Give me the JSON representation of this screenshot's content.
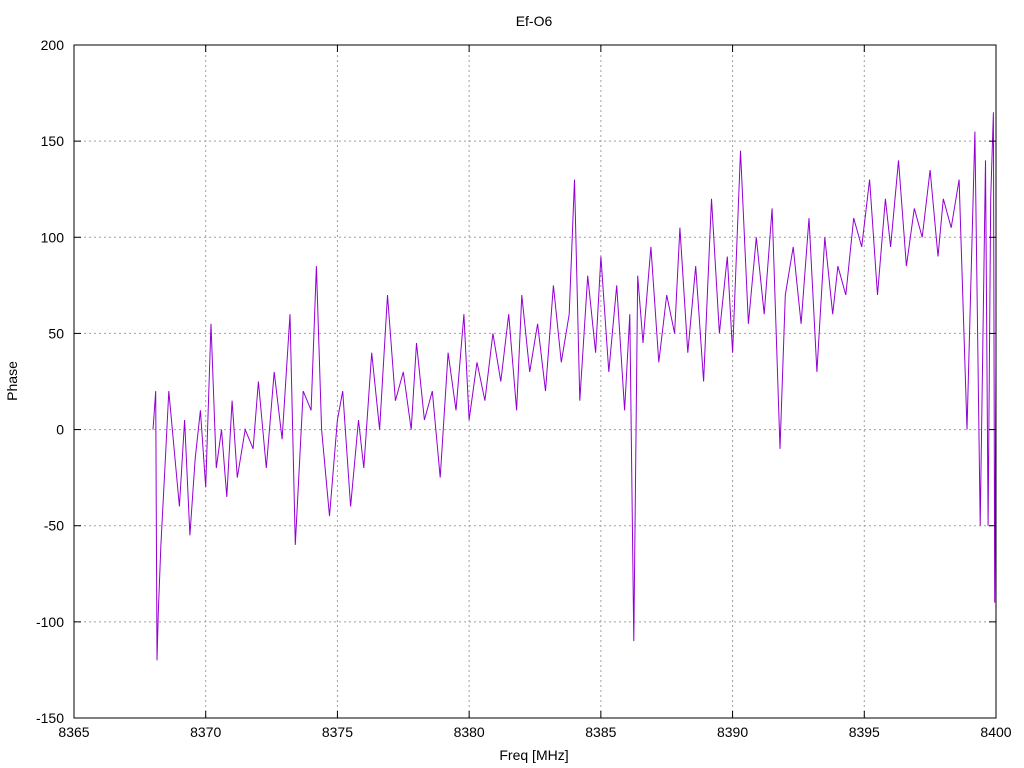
{
  "chart_data": {
    "type": "line",
    "title": "Ef-O6",
    "xlabel": "Freq [MHz]",
    "ylabel": "Phase",
    "xlim": [
      8365,
      8400
    ],
    "ylim": [
      -150,
      200
    ],
    "xticks": [
      8365,
      8370,
      8375,
      8380,
      8385,
      8390,
      8395,
      8400
    ],
    "yticks": [
      -150,
      -100,
      -50,
      0,
      50,
      100,
      150,
      200
    ],
    "grid": true,
    "legend": "none",
    "colors": {
      "series": "#9400d3",
      "grid": "#a0a0a0",
      "axes": "#000000"
    },
    "series": [
      {
        "x": [
          8368.0,
          8368.1,
          8368.15,
          8368.2,
          8368.3,
          8368.45,
          8368.6,
          8368.8,
          8369.0,
          8369.2,
          8369.4,
          8369.6,
          8369.8,
          8370.0,
          8370.2,
          8370.4,
          8370.6,
          8370.8,
          8371.0,
          8371.2,
          8371.5,
          8371.8,
          8372.0,
          8372.3,
          8372.6,
          8372.9,
          8373.2,
          8373.4,
          8373.7,
          8374.0,
          8374.2,
          8374.4,
          8374.7,
          8375.0,
          8375.2,
          8375.5,
          8375.8,
          8376.0,
          8376.3,
          8376.6,
          8376.9,
          8377.2,
          8377.5,
          8377.8,
          8378.0,
          8378.3,
          8378.6,
          8378.9,
          8379.2,
          8379.5,
          8379.8,
          8380.0,
          8380.3,
          8380.6,
          8380.9,
          8381.2,
          8381.5,
          8381.8,
          8382.0,
          8382.3,
          8382.6,
          8382.9,
          8383.2,
          8383.5,
          8383.8,
          8384.0,
          8384.2,
          8384.5,
          8384.8,
          8385.0,
          8385.3,
          8385.6,
          8385.9,
          8386.1,
          8386.25,
          8386.4,
          8386.6,
          8386.9,
          8387.2,
          8387.5,
          8387.8,
          8388.0,
          8388.3,
          8388.6,
          8388.9,
          8389.2,
          8389.5,
          8389.8,
          8390.0,
          8390.3,
          8390.6,
          8390.9,
          8391.2,
          8391.5,
          8391.8,
          8392.0,
          8392.3,
          8392.6,
          8392.9,
          8393.2,
          8393.5,
          8393.8,
          8394.0,
          8394.3,
          8394.6,
          8394.9,
          8395.2,
          8395.5,
          8395.8,
          8396.0,
          8396.3,
          8396.6,
          8396.9,
          8397.2,
          8397.5,
          8397.8,
          8398.0,
          8398.3,
          8398.6,
          8398.9,
          8399.2,
          8399.4,
          8399.6,
          8399.7,
          8399.8,
          8399.9,
          8399.95,
          8400.0
        ],
        "values": [
          0,
          20,
          -120,
          -95,
          -60,
          -20,
          20,
          -10,
          -40,
          5,
          -55,
          -15,
          10,
          -30,
          55,
          -20,
          0,
          -35,
          15,
          -25,
          0,
          -10,
          25,
          -20,
          30,
          -5,
          60,
          -60,
          20,
          10,
          85,
          0,
          -45,
          5,
          20,
          -40,
          5,
          -20,
          40,
          0,
          70,
          15,
          30,
          0,
          45,
          5,
          20,
          -25,
          40,
          10,
          60,
          5,
          35,
          15,
          50,
          25,
          60,
          10,
          70,
          30,
          55,
          20,
          75,
          35,
          60,
          130,
          15,
          80,
          40,
          90,
          30,
          75,
          10,
          60,
          -110,
          80,
          45,
          95,
          35,
          70,
          50,
          105,
          40,
          85,
          25,
          120,
          50,
          90,
          40,
          145,
          55,
          100,
          60,
          115,
          -10,
          70,
          95,
          55,
          110,
          30,
          100,
          60,
          85,
          70,
          110,
          95,
          130,
          70,
          120,
          95,
          140,
          85,
          115,
          100,
          135,
          90,
          120,
          105,
          130,
          0,
          155,
          -50,
          140,
          -50,
          120,
          165,
          -90,
          35
        ]
      }
    ]
  }
}
